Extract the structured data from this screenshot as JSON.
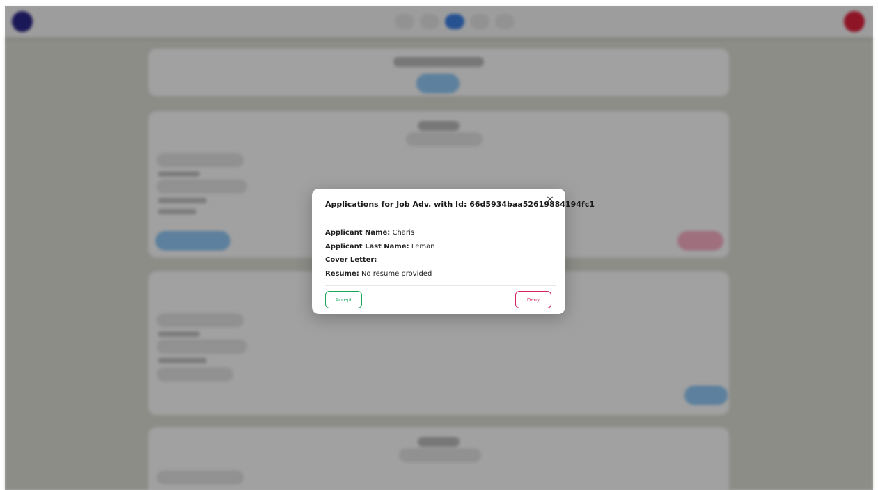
{
  "modal": {
    "title": "Applications for Job Adv. with Id: 66d5934baa52619884194fc1",
    "close_glyph": "×",
    "fields": {
      "applicant_name_label": "Applicant Name:",
      "applicant_name_value": "Charis",
      "applicant_last_name_label": "Applicant Last Name:",
      "applicant_last_name_value": "Leman",
      "cover_letter_label": "Cover Letter:",
      "cover_letter_value": "",
      "resume_label": "Resume:",
      "resume_value": "No resume provided"
    },
    "accept_label": "Accept",
    "deny_label": "Deny"
  },
  "colors": {
    "accept": "#19a85a",
    "deny": "#d3245c",
    "brand_logo": "#2a2585",
    "avatar": "#d8203a",
    "nav_active": "#3b7ddd"
  },
  "icons": {
    "close": "close-icon",
    "logo": "app-logo",
    "avatar": "user-avatar"
  }
}
